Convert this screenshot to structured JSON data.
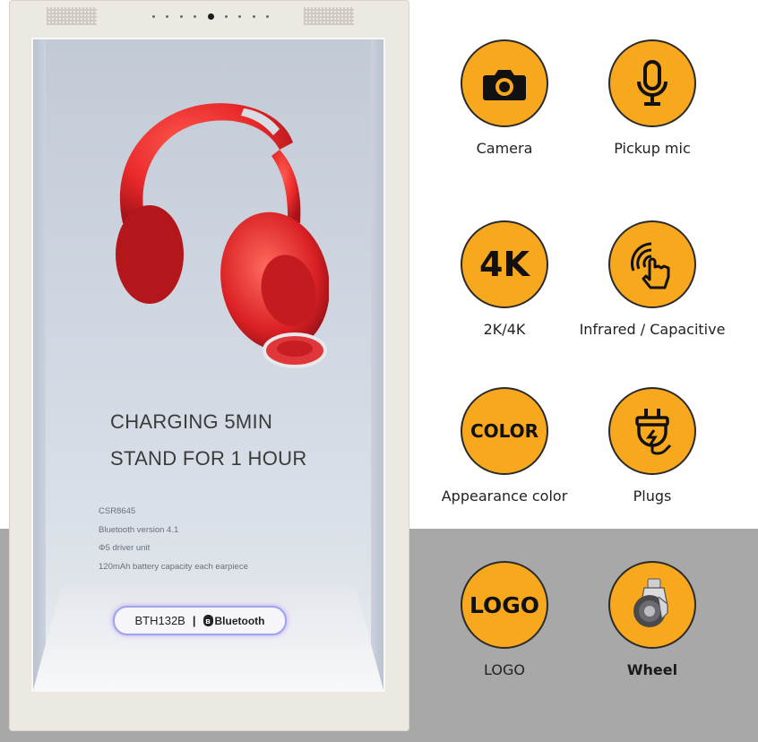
{
  "display": {
    "headline_line1": "CHARGING 5MIN",
    "headline_line2": "STAND FOR 1 HOUR",
    "specs": [
      "CSR8645",
      "Bluetooth version 4.1",
      "Φ5 driver unit",
      "120mAh battery capacity each earpiece"
    ],
    "model": "BTH132B",
    "separator": "|",
    "bluetooth_label": "Bluetooth",
    "bluetooth_symbol": "ʙ",
    "headphone_color": "#e8282a"
  },
  "features": [
    {
      "label": "Camera",
      "icon": "camera-icon"
    },
    {
      "label": "Pickup mic",
      "icon": "microphone-icon"
    },
    {
      "label": "2K/4K",
      "icon_text": "4K"
    },
    {
      "label": "Infrared / Capacitive",
      "icon": "touch-hand-icon"
    },
    {
      "label": "Appearance color",
      "icon_text": "COLOR"
    },
    {
      "label": "Plugs",
      "icon": "plug-icon"
    },
    {
      "label": "LOGO",
      "icon_text": "LOGO"
    },
    {
      "label": "Wheel",
      "icon": "caster-wheel-icon"
    }
  ],
  "colors": {
    "accent": "#f7a81d",
    "band": "#a8a8a8",
    "frame": "#ece9e2"
  }
}
